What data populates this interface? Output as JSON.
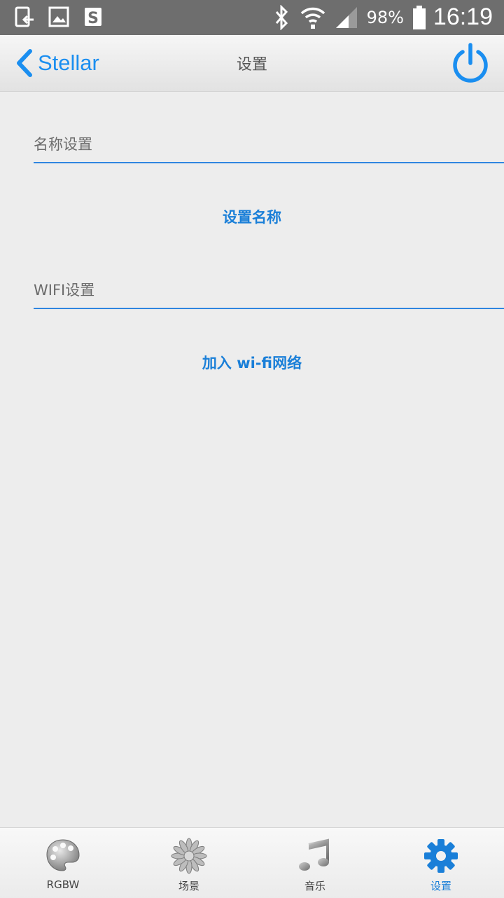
{
  "status_bar": {
    "battery_percent": "98%",
    "time": "16:19",
    "icons": [
      "screen-cast-icon",
      "image-icon",
      "s-note-icon",
      "bluetooth-icon",
      "wifi-icon",
      "signal-icon",
      "battery-icon"
    ]
  },
  "nav": {
    "back_label": "Stellar",
    "title": "设置",
    "accent": "#1a8ef0"
  },
  "sections": {
    "name": {
      "label": "名称设置",
      "action": "设置名称"
    },
    "wifi": {
      "label": "WIFI设置",
      "action": "加入 wi-fi网络"
    }
  },
  "tabs": [
    {
      "label": "RGBW",
      "icon": "palette-icon"
    },
    {
      "label": "场景",
      "icon": "flower-icon"
    },
    {
      "label": "音乐",
      "icon": "music-note-icon"
    },
    {
      "label": "设置",
      "icon": "gear-icon",
      "active": true
    }
  ]
}
